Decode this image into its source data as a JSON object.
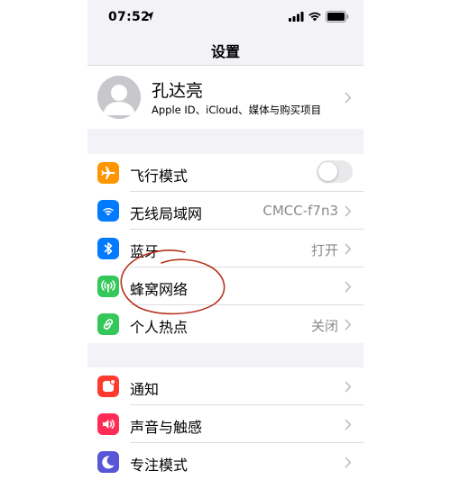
{
  "status_bar": {
    "time": "07:52"
  },
  "nav": {
    "title": "设置"
  },
  "profile": {
    "name": "孔达亮",
    "subtitle": "Apple ID、iCloud、媒体与购买项目"
  },
  "network_group": [
    {
      "label": "飞行模式",
      "icon": "airplane-icon",
      "color": "#ff9500",
      "toggle": false
    },
    {
      "label": "无线局域网",
      "value": "CMCC-f7n3",
      "icon": "wifi-icon",
      "color": "#007aff"
    },
    {
      "label": "蓝牙",
      "value": "打开",
      "icon": "bluetooth-icon",
      "color": "#007aff"
    },
    {
      "label": "蜂窝网络",
      "value": "",
      "icon": "cellular-icon",
      "color": "#34c759"
    },
    {
      "label": "个人热点",
      "value": "关闭",
      "icon": "hotspot-icon",
      "color": "#34c759"
    }
  ],
  "notify_group": [
    {
      "label": "通知",
      "icon": "notification-icon",
      "color": "#ff3b30"
    },
    {
      "label": "声音与触感",
      "icon": "sound-icon",
      "color": "#ff2d55"
    },
    {
      "label": "专注模式",
      "icon": "focus-moon-icon",
      "color": "#5856d6"
    }
  ],
  "annotation": {
    "color": "#b5341e",
    "description_target": "蜂窝网络"
  }
}
